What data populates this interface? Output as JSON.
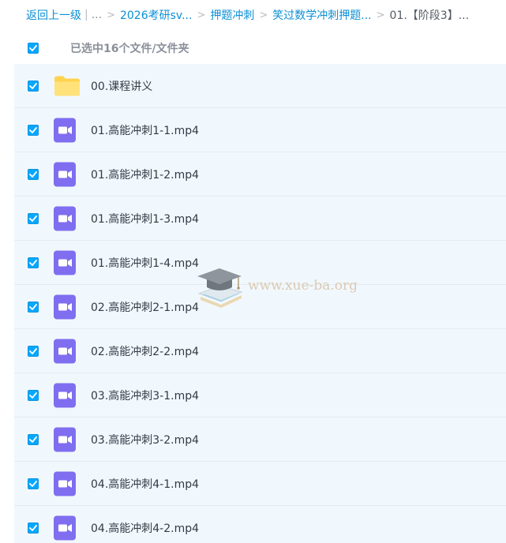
{
  "breadcrumb": {
    "back_label": "返回上一级",
    "bar": "|",
    "dots": "...",
    "separator": ">",
    "items": [
      "2026考研sv...",
      "押题冲刺",
      "笑过数学冲刺押题..."
    ],
    "current": "01.【阶段3】..."
  },
  "selection": {
    "text": "已选中16个文件/文件夹",
    "all_checked": true
  },
  "files": [
    {
      "name": "00.课程讲义",
      "type": "folder",
      "checked": true
    },
    {
      "name": "01.高能冲刺1-1.mp4",
      "type": "video",
      "checked": true
    },
    {
      "name": "01.高能冲刺1-2.mp4",
      "type": "video",
      "checked": true
    },
    {
      "name": "01.高能冲刺1-3.mp4",
      "type": "video",
      "checked": true
    },
    {
      "name": "01.高能冲刺1-4.mp4",
      "type": "video",
      "checked": true
    },
    {
      "name": "02.高能冲刺2-1.mp4",
      "type": "video",
      "checked": true
    },
    {
      "name": "02.高能冲刺2-2.mp4",
      "type": "video",
      "checked": true
    },
    {
      "name": "03.高能冲刺3-1.mp4",
      "type": "video",
      "checked": true
    },
    {
      "name": "03.高能冲刺3-2.mp4",
      "type": "video",
      "checked": true
    },
    {
      "name": "04.高能冲刺4-1.mp4",
      "type": "video",
      "checked": true
    },
    {
      "name": "04.高能冲刺4-2.mp4",
      "type": "video",
      "checked": true
    }
  ],
  "watermark": {
    "text": "www.xue-ba.org"
  },
  "colors": {
    "accent": "#06a7ff",
    "row_background": "#f1f8fd",
    "folder": "#ffd34f",
    "video": "#7f6ef0"
  },
  "icons": {
    "checkbox": "check-icon",
    "folder": "folder-icon",
    "video": "video-file-icon",
    "watermark": "graduation-cap-book-icon"
  }
}
